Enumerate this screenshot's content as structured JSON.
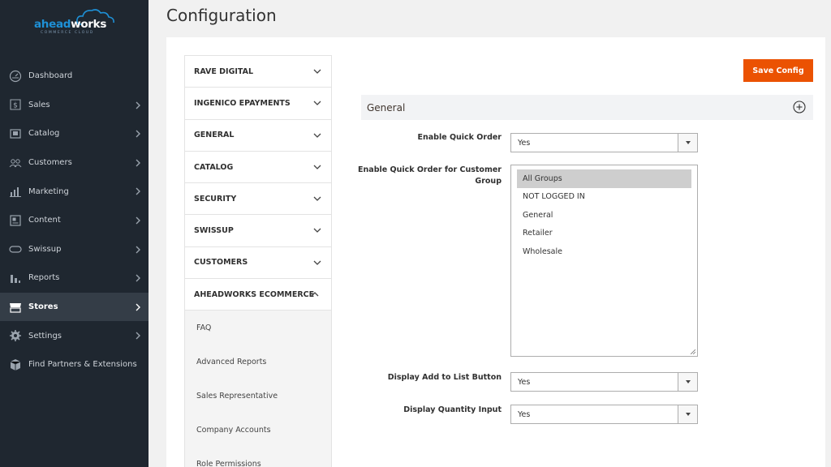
{
  "brand": {
    "name_blue": "ahead",
    "name_white": "works",
    "tagline": "COMMERCE CLOUD"
  },
  "sidebar": {
    "items": [
      {
        "label": "Dashboard",
        "icon": "dashboard-icon",
        "has_chevron": false,
        "active": false
      },
      {
        "label": "Sales",
        "icon": "dollar-icon",
        "has_chevron": true,
        "active": false
      },
      {
        "label": "Catalog",
        "icon": "catalog-icon",
        "has_chevron": true,
        "active": false
      },
      {
        "label": "Customers",
        "icon": "customers-icon",
        "has_chevron": true,
        "active": false
      },
      {
        "label": "Marketing",
        "icon": "marketing-icon",
        "has_chevron": true,
        "active": false
      },
      {
        "label": "Content",
        "icon": "content-icon",
        "has_chevron": true,
        "active": false
      },
      {
        "label": "Swissup",
        "icon": "swissup-icon",
        "has_chevron": true,
        "active": false
      },
      {
        "label": "Reports",
        "icon": "reports-icon",
        "has_chevron": true,
        "active": false
      },
      {
        "label": "Stores",
        "icon": "stores-icon",
        "has_chevron": true,
        "active": true
      },
      {
        "label": "Settings",
        "icon": "gear-icon",
        "has_chevron": true,
        "active": false
      },
      {
        "label": "Find Partners & Extensions",
        "icon": "extensions-icon",
        "has_chevron": false,
        "active": false
      }
    ]
  },
  "page": {
    "title": "Configuration",
    "save_label": "Save Config"
  },
  "tabs": {
    "items": [
      {
        "label": "RAVE DIGITAL",
        "expanded": false
      },
      {
        "label": "INGENICO EPAYMENTS",
        "expanded": false
      },
      {
        "label": "GENERAL",
        "expanded": false
      },
      {
        "label": "CATALOG",
        "expanded": false
      },
      {
        "label": "SECURITY",
        "expanded": false
      },
      {
        "label": "SWISSUP",
        "expanded": false
      },
      {
        "label": "CUSTOMERS",
        "expanded": false
      },
      {
        "label": "AHEADWORKS ECOMMERCE",
        "expanded": true
      }
    ],
    "subitems": [
      "FAQ",
      "Advanced Reports",
      "Sales Representative",
      "Company Accounts",
      "Role Permissions"
    ]
  },
  "section": {
    "title": "General"
  },
  "fields": {
    "enable_quick_order": {
      "label": "Enable Quick Order",
      "value": "Yes"
    },
    "customer_group": {
      "label": "Enable Quick Order for Customer Group",
      "options": [
        "All Groups",
        "NOT LOGGED IN",
        "General",
        "Retailer",
        "Wholesale"
      ],
      "selected": "All Groups"
    },
    "display_add_to_list": {
      "label": "Display Add to List Button",
      "value": "Yes"
    },
    "display_quantity": {
      "label": "Display Quantity Input",
      "value": "Yes"
    }
  },
  "colors": {
    "sidebar_bg": "#1f2730",
    "active_item_bg": "#343d47",
    "accent": "#eb5202",
    "brand_blue": "#1e90d6"
  }
}
